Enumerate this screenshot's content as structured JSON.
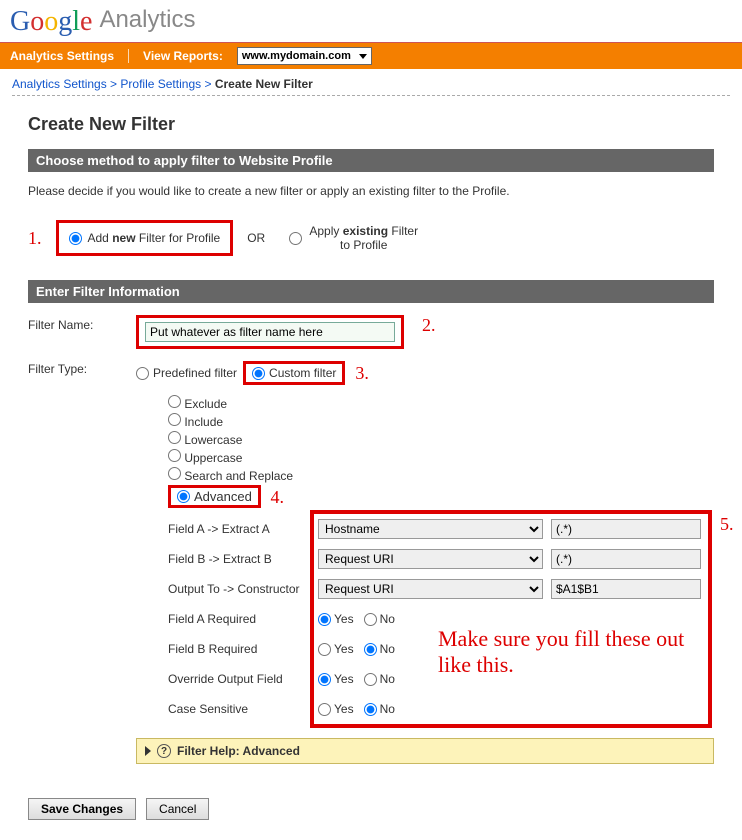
{
  "logo": {
    "google": "Google",
    "analytics": "Analytics"
  },
  "nav": {
    "settings": "Analytics Settings",
    "view_reports": "View Reports:",
    "domain": "www.mydomain.com"
  },
  "breadcrumb": {
    "a": "Analytics Settings",
    "b": "Profile Settings",
    "current": "Create New Filter"
  },
  "page_title": "Create New Filter",
  "section1_title": "Choose method to apply filter to Website Profile",
  "section1_desc": "Please decide if you would like to create a new filter or apply an existing filter to the Profile.",
  "nums": {
    "n1": "1.",
    "n2": "2.",
    "n3": "3.",
    "n4": "4.",
    "n5": "5."
  },
  "method": {
    "add_pre": "Add ",
    "add_bold": "new",
    "add_post": " Filter for Profile",
    "or": "OR",
    "apply_pre": "Apply ",
    "apply_bold": "existing",
    "apply_post": " Filter to Profile"
  },
  "section2_title": "Enter Filter Information",
  "labels": {
    "filter_name": "Filter Name:",
    "filter_type": "Filter Type:"
  },
  "filter_name_value": "Put whatever as filter name here",
  "filter_type": {
    "predefined": "Predefined filter",
    "custom": "Custom filter"
  },
  "custom_options": {
    "exclude": "Exclude",
    "include": "Include",
    "lowercase": "Lowercase",
    "uppercase": "Uppercase",
    "search_replace": "Search and Replace",
    "advanced": "Advanced"
  },
  "adv": {
    "field_a": "Field A -> Extract A",
    "field_b": "Field B -> Extract B",
    "output": "Output To -> Constructor",
    "field_a_req": "Field A Required",
    "field_b_req": "Field B Required",
    "override": "Override Output Field",
    "case_sens": "Case Sensitive",
    "sel_hostname": "Hostname",
    "sel_request_uri": "Request URI",
    "val_star": "(.*)",
    "val_out": "$A1$B1",
    "yes": "Yes",
    "no": "No"
  },
  "red_note": "Make sure you fill these out like this.",
  "filter_help": "Filter Help: Advanced",
  "buttons": {
    "save": "Save Changes",
    "cancel": "Cancel"
  }
}
